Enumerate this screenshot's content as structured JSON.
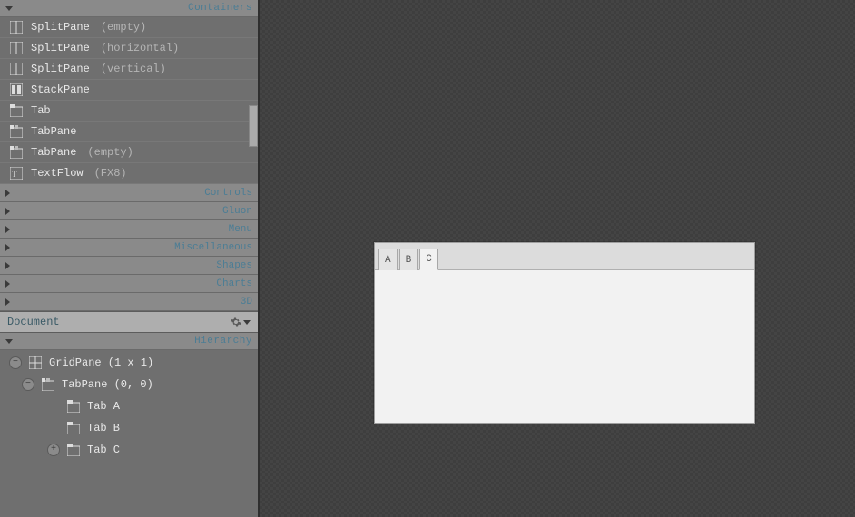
{
  "library": {
    "expanded_category": "Containers",
    "items": [
      {
        "name": "SplitPane",
        "suffix": "(empty)",
        "icon": "splitpane"
      },
      {
        "name": "SplitPane",
        "suffix": "(horizontal)",
        "icon": "splitpane"
      },
      {
        "name": "SplitPane",
        "suffix": "(vertical)",
        "icon": "splitpane"
      },
      {
        "name": "StackPane",
        "suffix": "",
        "icon": "stackpane"
      },
      {
        "name": "Tab",
        "suffix": "",
        "icon": "tab"
      },
      {
        "name": "TabPane",
        "suffix": "",
        "icon": "tabpane"
      },
      {
        "name": "TabPane",
        "suffix": "(empty)",
        "icon": "tabpane"
      },
      {
        "name": "TextFlow",
        "suffix": "(FX8)",
        "icon": "textflow"
      }
    ],
    "collapsed_categories": [
      "Controls",
      "Gluon",
      "Menu",
      "Miscellaneous",
      "Shapes",
      "Charts",
      "3D"
    ]
  },
  "document": {
    "title": "Document",
    "hierarchy_label": "Hierarchy",
    "tree": [
      {
        "label": "GridPane (1 x 1)",
        "indent": 0,
        "toggle": "minus",
        "icon": "grid"
      },
      {
        "label": "TabPane (0, 0)",
        "indent": 1,
        "toggle": "minus",
        "icon": "tabpane"
      },
      {
        "label": "Tab A",
        "indent": 2,
        "toggle": "",
        "icon": "tab"
      },
      {
        "label": "Tab B",
        "indent": 2,
        "toggle": "",
        "icon": "tab"
      },
      {
        "label": "Tab C",
        "indent": 2,
        "toggle": "plus",
        "icon": "tab"
      }
    ]
  },
  "preview": {
    "tabs": [
      "A",
      "B",
      "C"
    ],
    "active_index": 2
  }
}
